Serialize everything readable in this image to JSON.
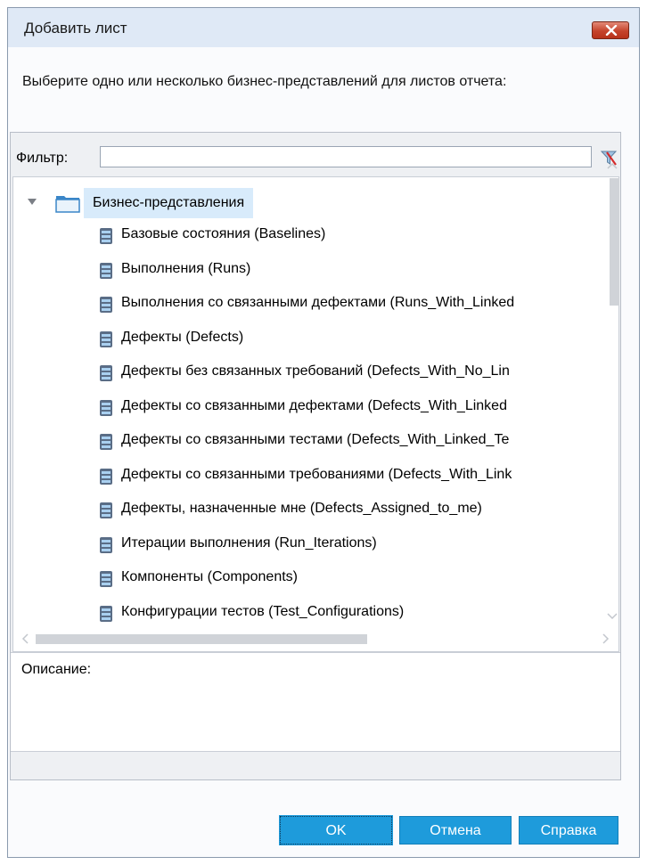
{
  "window": {
    "title": "Добавить лист"
  },
  "prompt": "Выберите одно или несколько бизнес-представлений для листов отчета:",
  "filter": {
    "label": "Фильтр:",
    "value": "",
    "icon": "clear-filter-icon"
  },
  "tree": {
    "root": {
      "label": "Бизнес-представления",
      "icon": "folder-icon",
      "expanded": true
    },
    "items": [
      {
        "label": "Базовые состояния (Baselines)"
      },
      {
        "label": "Выполнения (Runs)"
      },
      {
        "label": "Выполнения со связанными дефектами (Runs_With_Linked"
      },
      {
        "label": "Дефекты (Defects)"
      },
      {
        "label": "Дефекты без связанных требований (Defects_With_No_Lin"
      },
      {
        "label": "Дефекты со связанными дефектами (Defects_With_Linked"
      },
      {
        "label": "Дефекты со связанными тестами (Defects_With_Linked_Te"
      },
      {
        "label": "Дефекты со связанными требованиями (Defects_With_Link"
      },
      {
        "label": "Дефекты, назначенные мне (Defects_Assigned_to_me)"
      },
      {
        "label": "Итерации выполнения (Run_Iterations)"
      },
      {
        "label": "Компоненты (Components)"
      },
      {
        "label": "Конфигурации тестов (Test_Configurations)"
      }
    ]
  },
  "description": {
    "label": "Описание:"
  },
  "buttons": {
    "ok": "OK",
    "cancel": "Отмена",
    "help": "Справка"
  },
  "colors": {
    "button": "#1e9bdb",
    "selection": "#d8ebfb",
    "titlebar": "#dfe9f6",
    "close": "#c5432b"
  }
}
